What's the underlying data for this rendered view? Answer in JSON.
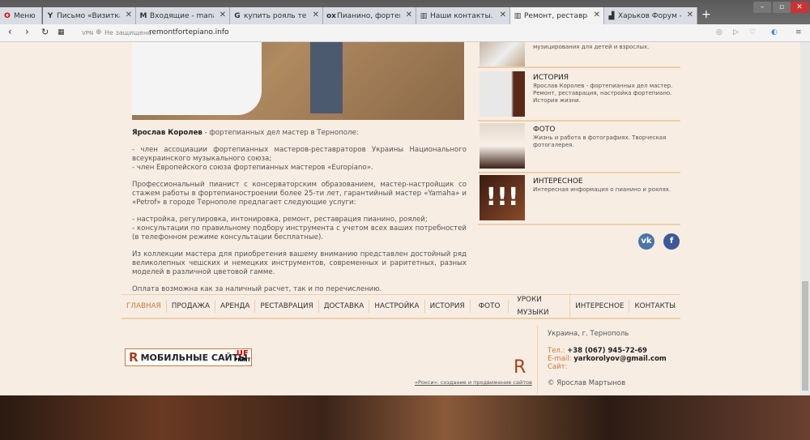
{
  "browser": {
    "menu_label": "Меню",
    "tabs": [
      {
        "title": "Письмо «Визитка Инст",
        "icon": "Y"
      },
      {
        "title": "Входящие - manabat.ro",
        "icon": "M"
      },
      {
        "title": "купить рояль тернопо",
        "icon": "G"
      },
      {
        "title": "Пианино, фортепиано",
        "icon": "ox"
      },
      {
        "title": "Наши контакты. Ремо",
        "icon": "▥"
      },
      {
        "title": "Ремонт, реставрация, д",
        "icon": "▥"
      },
      {
        "title": "Харьков Форум - Созд",
        "icon": "▟"
      }
    ],
    "vpn": "VPN",
    "security": "Не защищено",
    "url": "remontfortepiano.info"
  },
  "sidebar": [
    {
      "title": "",
      "desc": "музицирования для детей и взрослых."
    },
    {
      "title": "ИСТОРИЯ",
      "desc": "Ярослав Королев - фортепианных дел мастер. Ремонт, реставрация, настройка фортепиано. История жизни."
    },
    {
      "title": "ФОТО",
      "desc": "Жизнь и работа в фотографиях. Творческая фотогалерея."
    },
    {
      "title": "ИНТЕРЕСНОЕ",
      "desc": "Интересная информация о пианино и роялях."
    }
  ],
  "social": {
    "vk": "vk",
    "fb": "f"
  },
  "main": {
    "name": "Ярослав Королев",
    "intro": " - фортепианных дел мастер в Тернополе:",
    "p1": "- член ассоциации фортепианных мастеров-реставраторов Украины Национального всеукраинского музыкального союза;",
    "p1b": "- член Европейского союза фортепианных мастеров «Europiano».",
    "p2": "Профессиональный пианист с консерваторским образованием, мастер-настройщик со стажем работы в фортепианостроении более 25-ти лет, гарантийный мастер «Yamaha» и «Petrof» в городе Тернополе предлагает следующие услуги:",
    "p3": "- настройка, регулировка, интонировка, ремонт, реставрация пианино, роялей;",
    "p3b": "- консультации по правильному подбору инструмента с учетом всех ваших потребностей (в телефонном режиме консультации бесплатные).",
    "p4": "Из коллекции мастера для приобретения вашему вниманию представлен достойный ряд великолепных чешских и немецких инструментов, современных и раритетных, разных моделей в различной цветовой гамме.",
    "p5": "Оплата возможна как за наличный расчет, так и по перечислению."
  },
  "nav": [
    "ГЛАВНАЯ",
    "ПРОДАЖА",
    "АРЕНДА",
    "РЕСТАВРАЦИЯ",
    "ДОСТАВКА",
    "НАСТРОЙКА",
    "ИСТОРИЯ",
    "ФОТО",
    "УРОКИ МУЗЫКИ",
    "ИНТЕРЕСНОЕ",
    "КОНТАКТЫ"
  ],
  "footer": {
    "logo1": "МОБИЛЬНЫЕ САЙТЫ",
    "logo1_r": "R",
    "logo2": "UF",
    "logo2b": "PRINT",
    "roksi_r": "R",
    "roksi_link": "«Рокси»: создание и продвижение сайтов",
    "address": "Украина, г. Тернополь",
    "tel_label": "Тел.:",
    "tel": "+38 (067) 945-72-69",
    "email_label": "E-mail:",
    "email": "yarkorolyov@gmail.com",
    "site_label": "Сайт:",
    "copyright": "© Ярослав Мартынов"
  }
}
